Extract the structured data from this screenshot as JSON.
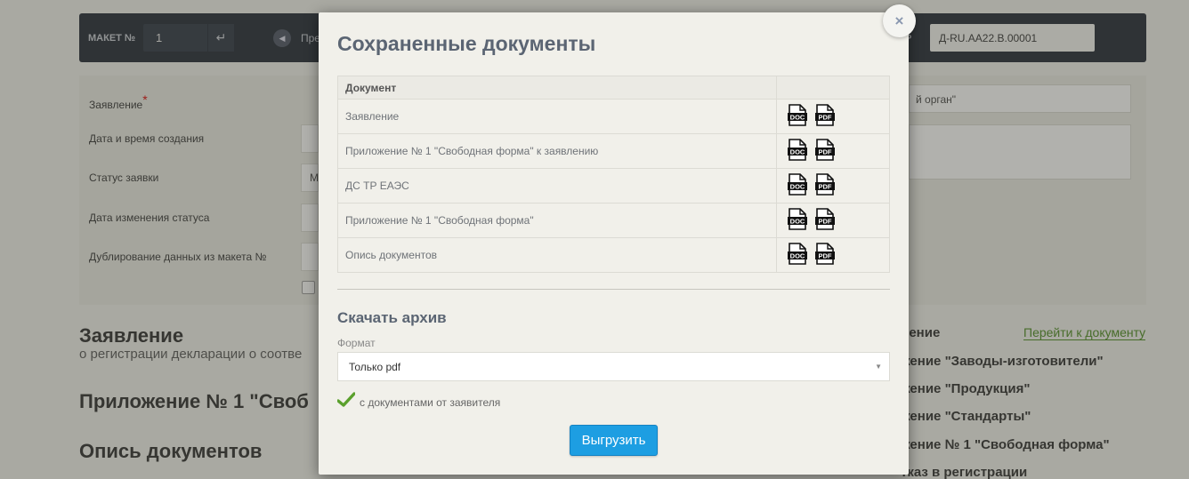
{
  "background": {
    "topbar": {
      "maket_label": "МАКЕТ №",
      "maket_value": "1",
      "enter_glyph": "↵",
      "prev_label": "Пре",
      "reg_label": "ЕР",
      "reg_value": "Д-RU.АА22.В.00001"
    },
    "form": {
      "rows": [
        "Заявление",
        "Дата и время создания",
        "Статус заявки",
        "Дата изменения статуса",
        "Дублирование данных из макета №"
      ],
      "required_mark": "*",
      "status_value_fragment": "М",
      "right_field_fragment": "й орган\""
    },
    "headings": {
      "zayavlenie": "Заявление",
      "zayavlenie_sub": "о регистрации декларации о соотве",
      "prilozhenie": "Приложение № 1 \"Своб",
      "opis": "Опись документов"
    },
    "goto_link": "Перейти к документу",
    "right_list": [
      "ление",
      "жение \"Заводы-изготовители\"",
      "жение \"Продукция\"",
      "жение \"Стандарты\"",
      "жение № 1 \"Свободная форма\"",
      "тказ в регистрации"
    ]
  },
  "modal": {
    "close_glyph": "×",
    "title": "Сохраненные документы",
    "table": {
      "header": "Документ",
      "rows": [
        {
          "name": "Заявление"
        },
        {
          "name": "Приложение № 1 \"Свободная форма\" к заявлению"
        },
        {
          "name": "ДС ТР ЕАЭС"
        },
        {
          "name": "Приложение № 1 \"Свободная форма\""
        },
        {
          "name": "Опись документов"
        }
      ],
      "doc_icon_label": "DOC",
      "pdf_icon_label": "PDF"
    },
    "archive_title": "Скачать архив",
    "format_label": "Формат",
    "format_value": "Только pdf",
    "caret_glyph": "▼",
    "with_applicant_docs": "с документами от заявителя",
    "with_applicant_docs_checked": true,
    "export_button": "Выгрузить"
  },
  "colors": {
    "accent_button": "#1d9ee2",
    "checkmark": "#5aa02c",
    "link": "#4a8a1f",
    "topbar": "#1f2633"
  }
}
